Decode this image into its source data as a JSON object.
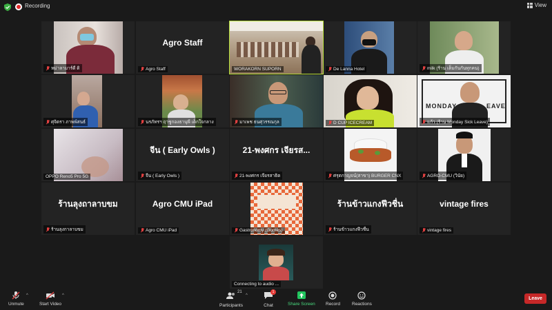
{
  "topbar": {
    "recording_label": "Recording",
    "view_label": "View"
  },
  "tiles": [
    {
      "name": "หม่าลามาร์ดี ดิ",
      "muted": true
    },
    {
      "name": "Agro Staff",
      "display": "Agro Staff",
      "muted": true
    },
    {
      "name": "WORAKORN SUPORN",
      "muted": false,
      "active": true
    },
    {
      "name": "De Lanna Hotel",
      "muted": true
    },
    {
      "name": "milk (ร้าน เต็มกันกันทุกคน)",
      "muted": true
    },
    {
      "name": "ศุจิตรา ภาพพ์สนธ์",
      "muted": true
    },
    {
      "name": "นรภัทรฯ ฤาชูกองธานุพี เด็กใจกลาง",
      "muted": true
    },
    {
      "name": "มาเพช ธนศุวรรณกุล",
      "muted": true
    },
    {
      "name": "D CUP ICECREAM",
      "muted": true
    },
    {
      "name": "แก้ว (ร้าน Monday Sick Leave)",
      "muted": true
    },
    {
      "name": "OPPO Reno5 Pro 5G",
      "muted": false
    },
    {
      "name": "จีน ( Early Owls )",
      "display": "จีน ( Early Owls )",
      "muted": true
    },
    {
      "name": "21-พงศกร เจียรสาธิต",
      "display": "21-พงศกร เจียรส...",
      "muted": true
    },
    {
      "name": "ศรุตกาญจน์(สาขา) BURGER CNX",
      "muted": true
    },
    {
      "name": "AGRO-CMU (วินัย)",
      "muted": true
    },
    {
      "name": "ร้านลุงกาลาบขม",
      "display": "ร้านลุงถาลาบขม",
      "muted": true
    },
    {
      "name": "Agro CMU iPad",
      "display": "Agro CMU iPad",
      "muted": true
    },
    {
      "name": "Gastronomy (Gomes)",
      "muted": true
    },
    {
      "name": "ร้านข้าวแกงฟีวชื่น",
      "display": "ร้านข้าวแกงฟีวชื่น",
      "muted": true
    },
    {
      "name": "vintage fires",
      "display": "vintage fires",
      "muted": true
    },
    {
      "name": "Connecting to audio ...",
      "muted": false
    }
  ],
  "toolbar": {
    "unmute_label": "Unmute",
    "start_video_label": "Start Video",
    "participants_label": "Participants",
    "participants_count": "21",
    "chat_label": "Chat",
    "chat_badge": "1",
    "share_label": "Share Screen",
    "record_label": "Record",
    "reactions_label": "Reactions",
    "leave_label": "Leave"
  },
  "colors": {
    "accent": "#4ade80",
    "active_outline": "#b9e23a",
    "leave": "#c62828",
    "muted_mic": "#e04040"
  }
}
